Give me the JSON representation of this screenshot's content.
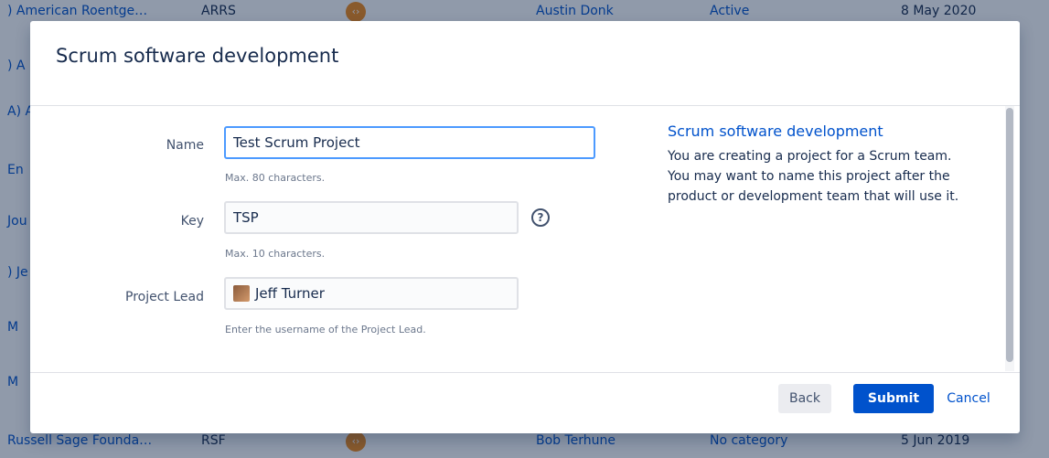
{
  "background": {
    "top_row": {
      "name": ") American Roentge…",
      "key": "ARRS",
      "lead": "Austin Donk",
      "category": "Active",
      "date": "8 May 2020"
    },
    "bottom_row": {
      "name": "Russell Sage Founda…",
      "key": "RSF",
      "lead": "Bob Terhune",
      "category": "No category",
      "date": "5 Jun 2019"
    },
    "side_fragments": [
      ") A",
      "A) A",
      "En",
      "Jou",
      ") Je",
      "M",
      "M"
    ]
  },
  "dialog": {
    "title": "Scrum software development",
    "name": {
      "label": "Name",
      "value": "Test Scrum Project",
      "help": "Max. 80 characters."
    },
    "key": {
      "label": "Key",
      "value": "TSP",
      "help": "Max. 10 characters.",
      "help_icon": "question-circle-icon"
    },
    "lead": {
      "label": "Project Lead",
      "value": "Jeff Turner",
      "help": "Enter the username of the Project Lead."
    },
    "info": {
      "title": "Scrum software development",
      "text": "You are creating a project for a Scrum team. You may want to name this project after the product or development team that will use it."
    },
    "buttons": {
      "back": "Back",
      "submit": "Submit",
      "cancel": "Cancel"
    }
  },
  "colors": {
    "primary": "#0052cc",
    "overlay": "rgba(9,30,66,0.45)",
    "text": "#172b4d"
  }
}
